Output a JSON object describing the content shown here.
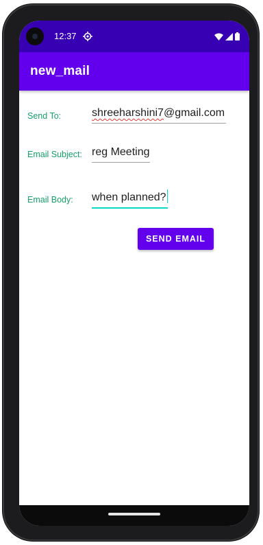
{
  "status_bar": {
    "time": "12:37",
    "icons": [
      "gps-icon",
      "wifi-icon",
      "signal-icon",
      "battery-icon"
    ]
  },
  "app_bar": {
    "title": "new_mail",
    "color": "#6200ee",
    "status_color": "#3700b3"
  },
  "form": {
    "send_to": {
      "label": "Send To:",
      "value": "shreeharshini7@gmail.com",
      "misspelled_part": "shreeharshini7",
      "rest": "@gmail.com"
    },
    "subject": {
      "label": "Email Subject:",
      "value": "reg Meeting"
    },
    "body": {
      "label": "Email Body:",
      "value": "when planned?"
    },
    "label_color": "#16a06a",
    "focus_color": "#03dac5"
  },
  "send_button": {
    "label": "SEND EMAIL"
  }
}
